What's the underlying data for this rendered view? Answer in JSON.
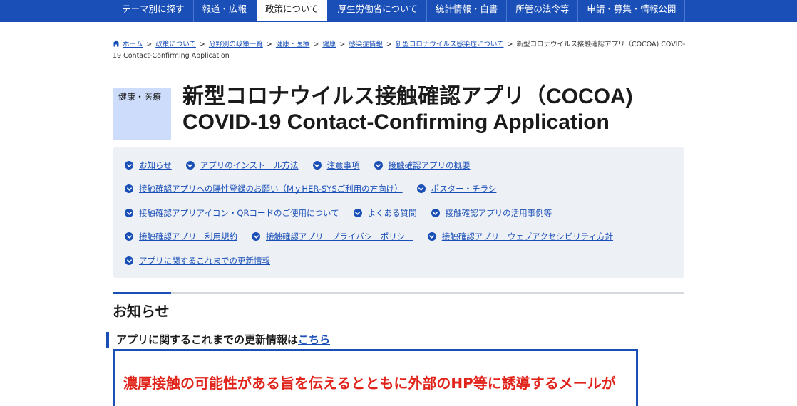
{
  "top_nav": {
    "items": [
      {
        "label": "テーマ別に探す",
        "active": false
      },
      {
        "label": "報道・広報",
        "active": false
      },
      {
        "label": "政策について",
        "active": true
      },
      {
        "label": "厚生労働省について",
        "active": false
      },
      {
        "label": "統計情報・白書",
        "active": false
      },
      {
        "label": "所管の法令等",
        "active": false
      },
      {
        "label": "申請・募集・情報公開",
        "active": false
      }
    ]
  },
  "breadcrumb": {
    "home": "ホーム",
    "items": [
      "政策について",
      "分野別の政策一覧",
      "健康・医療",
      "健康",
      "感染症情報",
      "新型コロナウイルス感染症について"
    ],
    "current": "新型コロナウイルス接触確認アプリ（COCOA) COVID-19 Contact-Confirming Application"
  },
  "category_tag": "健康・医療",
  "page_title": "新型コロナウイルス接触確認アプリ（COCOA) COVID-19 Contact-Confirming Application",
  "toc": {
    "rows": [
      [
        "お知らせ",
        "アプリのインストール方法",
        "注意事項",
        "接触確認アプリの概要"
      ],
      [
        "接触確認アプリへの陽性登録のお願い（MｙHER-SYSご利用の方向け）",
        "ポスター・チラシ"
      ],
      [
        "接触確認アプリアイコン・QRコードのご使用について",
        "よくある質問",
        "接触確認アプリの活用事例等"
      ],
      [
        "接触確認アプリ　利用規約",
        "接触確認アプリ　プライバシーポリシー",
        "接触確認アプリ　ウェブアクセシビリティ方針"
      ],
      [
        "アプリに関するこれまでの更新情報"
      ]
    ]
  },
  "section_title": "お知らせ",
  "sub_heading": {
    "text": "アプリに関するこれまでの更新情報は",
    "link": "こちら"
  },
  "notice_text": "濃厚接触の可能性がある旨を伝えるとともに外部のHP等に誘導するメールが",
  "colors": {
    "brand_blue": "#1a4fb7",
    "toc_bg": "#edf0f5",
    "tag_bg": "#ccdcfa",
    "alert_red": "#e0241b"
  }
}
